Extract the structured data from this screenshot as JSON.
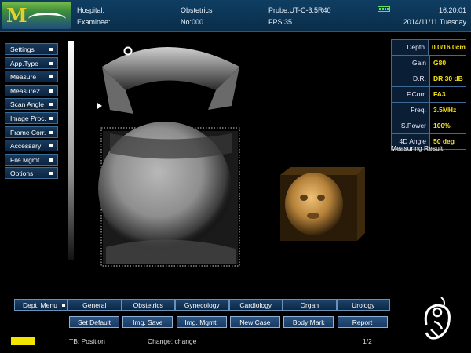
{
  "header": {
    "hospital_label": "Hospital:",
    "examinee_label": "Examinee:",
    "exam_type": "Obstetrics",
    "exam_no": "No:000",
    "probe": "Probe:UT-C-3.5R40",
    "fps": "FPS:35",
    "time": "16:20:01",
    "date": "2014/11/11 Tuesday"
  },
  "left_menu": [
    "Settings",
    "App.Type",
    "Measure",
    "Measure2",
    "Scan Angle",
    "Image Proc.",
    "Frame Corr.",
    "Accessary",
    "File Mgmt.",
    "Options"
  ],
  "params": [
    {
      "label": "Depth",
      "value": "0.0/16.0cm"
    },
    {
      "label": "Gain",
      "value": "G80"
    },
    {
      "label": "D.R.",
      "value": "DR 30 dB"
    },
    {
      "label": "F.Corr.",
      "value": "FA3"
    },
    {
      "label": "Freq.",
      "value": "3.5MHz"
    },
    {
      "label": "S.Power",
      "value": "100%"
    },
    {
      "label": "4D Angle",
      "value": "50 deg"
    }
  ],
  "measuring_result_label": "Measuring Result:",
  "dept_menu": {
    "label": "Dept. Menu",
    "items": [
      "General",
      "Obstetrics",
      "Gynecology",
      "Cardiology",
      "Organ",
      "Urology"
    ]
  },
  "functions": [
    "Set Default",
    "Img. Save",
    "Img. Mgmt.",
    "New Case",
    "Body Mark",
    "Report"
  ],
  "status": {
    "tb": "TB: Position",
    "change": "Change: change",
    "page": "1/2"
  },
  "colors": {
    "accent_yellow": "#f1e500",
    "header_bg": "#0f3e63",
    "volume_tint": "#c8903a"
  }
}
